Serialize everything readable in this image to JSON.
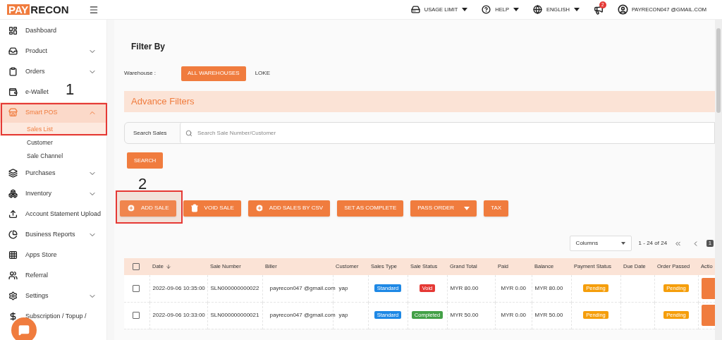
{
  "logo": {
    "part1": "PAY",
    "part2": "RECON"
  },
  "header": {
    "items": [
      {
        "kind": "dropdown",
        "label": "USAGE LIMIT"
      },
      {
        "kind": "dropdown",
        "label": "HELP"
      },
      {
        "kind": "dropdown",
        "label": "ENGLISH"
      },
      {
        "kind": "notify",
        "badge": "2"
      },
      {
        "kind": "user",
        "label": "PAYRECON047 @GMAIL.COM"
      }
    ]
  },
  "sidebar": {
    "items": [
      {
        "label": "Dashboard",
        "selected": false
      },
      {
        "label": "Product",
        "expanded": false,
        "selected": false
      },
      {
        "label": "Orders",
        "expanded": false,
        "selected": false
      },
      {
        "label": "e-Wallet",
        "selected": false
      },
      {
        "label": "Smart POS",
        "expanded": true,
        "selected": true,
        "children": [
          {
            "label": "Sales List",
            "selected": true
          },
          {
            "label": "Customer",
            "selected": false
          },
          {
            "label": "Sale Channel",
            "selected": false
          }
        ]
      },
      {
        "label": "Purchases",
        "expanded": false,
        "selected": false
      },
      {
        "label": "Inventory",
        "expanded": false,
        "selected": false
      },
      {
        "label": "Account Statement Upload",
        "selected": false
      },
      {
        "label": "Business Reports",
        "expanded": false,
        "selected": false
      },
      {
        "label": "Apps Store",
        "selected": false
      },
      {
        "label": "Referral",
        "selected": false
      },
      {
        "label": "Settings",
        "expanded": false,
        "selected": false
      },
      {
        "label": "Subscription / Topup /",
        "selected": false
      }
    ]
  },
  "annotations": [
    {
      "label": "1"
    },
    {
      "label": "2"
    }
  ],
  "filter": {
    "title": "Filter By",
    "warehouse_label": "Warehouse :",
    "warehouses": [
      {
        "label": "ALL WAREHOUSES",
        "selected": true
      },
      {
        "label": "LOKE",
        "selected": false
      }
    ],
    "advance_title": "Advance Filters",
    "search_label": "Search Sales",
    "search_placeholder": "Search Sale Number/Customer",
    "search_button": "SEARCH"
  },
  "actions": [
    {
      "kind": "plus",
      "label": "ADD SALE",
      "highlighted": true
    },
    {
      "kind": "trash",
      "label": "VOID SALE",
      "highlighted": false
    },
    {
      "kind": "plus",
      "label": "ADD SALES BY CSV",
      "highlighted": false
    },
    {
      "kind": "plain",
      "label": "SET AS COMPLETE",
      "highlighted": false
    },
    {
      "kind": "dropdown",
      "label": "PASS ORDER",
      "highlighted": false
    },
    {
      "kind": "plain",
      "label": "TAX",
      "highlighted": false
    }
  ],
  "table_tools": {
    "columns_select": "Columns",
    "range": "1 - 24 of 24",
    "page": "1"
  },
  "table": {
    "all_checked": false,
    "columns": [
      "Date",
      "Sale Number",
      "Biller",
      "Customer",
      "Sales Type",
      "Sale Status",
      "Grand Total",
      "Paid",
      "Balance",
      "Payment Status",
      "Due Date",
      "Order Passed",
      "Actio"
    ],
    "rows": [
      {
        "checked": false,
        "date": "2022-09-06 10:35:00",
        "number": "SLN000000000022",
        "biller": "payrecon047 @gmail.com",
        "customer": "yap",
        "type": "Standard",
        "status": "Void",
        "color": "#e53935",
        "total": "MYR 80.00",
        "paid": "MYR 0.00",
        "balance": "MYR 80.00",
        "payment": "Pending",
        "order": "Pending"
      },
      {
        "checked": false,
        "date": "2022-09-06 10:33:00",
        "number": "SLN000000000021",
        "biller": "payrecon047 @gmail.com",
        "customer": "yap",
        "type": "Standard",
        "status": "Completed",
        "color": "#43a047",
        "total": "MYR 50.00",
        "paid": "MYR 0.00",
        "balance": "MYR 50.00",
        "payment": "Pending",
        "order": "Pending"
      }
    ]
  }
}
